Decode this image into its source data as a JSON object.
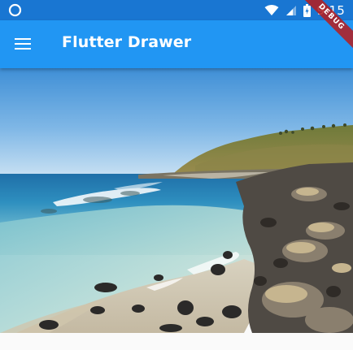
{
  "status_bar": {
    "time": "9:15",
    "left_icon": "circle-notification-icon",
    "right_icons": [
      "wifi-icon",
      "cellular-signal-icon",
      "battery-charging-icon"
    ],
    "color": "#1976d2"
  },
  "debug_banner": {
    "label": "DEBUG",
    "color": "#b71c1c"
  },
  "app_bar": {
    "title": "Flutter Drawer",
    "menu_icon": "hamburger-menu-icon",
    "color": "#2196f3"
  },
  "content": {
    "image": "coastal-beach-photo"
  }
}
